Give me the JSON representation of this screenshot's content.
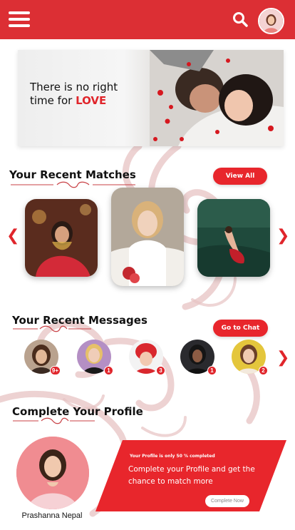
{
  "colors": {
    "brand": "#dc2f34",
    "accent": "#e8262c",
    "swirl": "#e7c3c3"
  },
  "header": {
    "menu_icon": "hamburger-menu-icon",
    "search_icon": "search-icon"
  },
  "banner": {
    "line1": "There is no right",
    "line2_prefix": "time for ",
    "line2_highlight": "LOVE"
  },
  "matches": {
    "title": "Your Recent Matches",
    "view_all_label": "View All"
  },
  "messages": {
    "title": "Your Recent Messages",
    "go_to_chat_label": "Go to Chat",
    "items": [
      {
        "badge": "9+"
      },
      {
        "badge": "1"
      },
      {
        "badge": "3"
      },
      {
        "badge": "1"
      },
      {
        "badge": "2"
      }
    ]
  },
  "profile": {
    "title": "Complete Your Profile",
    "name": "Prashanna Nepal",
    "completion_text": "Your Profile is only 50 % completed",
    "prompt": "Complete your Profile and get the chance to match more",
    "button_label": "Complete Now"
  }
}
